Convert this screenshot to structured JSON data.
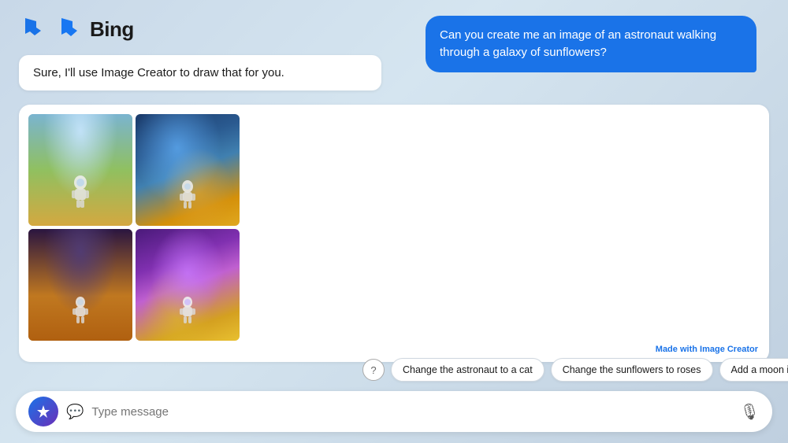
{
  "header": {
    "logo_text": "Bing",
    "logo_alt": "Bing logo"
  },
  "messages": {
    "user_message": "Can you create me an image of an astronaut walking through a galaxy of sunflowers?",
    "bot_message": "Sure, I'll use Image Creator to draw that for you.",
    "made_with_prefix": "Made with ",
    "made_with_link": "Image Creator"
  },
  "suggestions": {
    "help_label": "?",
    "chip1": "Change the astronaut to a cat",
    "chip2": "Change the sunflowers to roses",
    "chip3": "Add a moon in the background"
  },
  "input": {
    "placeholder": "Type message",
    "mic_label": "microphone"
  }
}
